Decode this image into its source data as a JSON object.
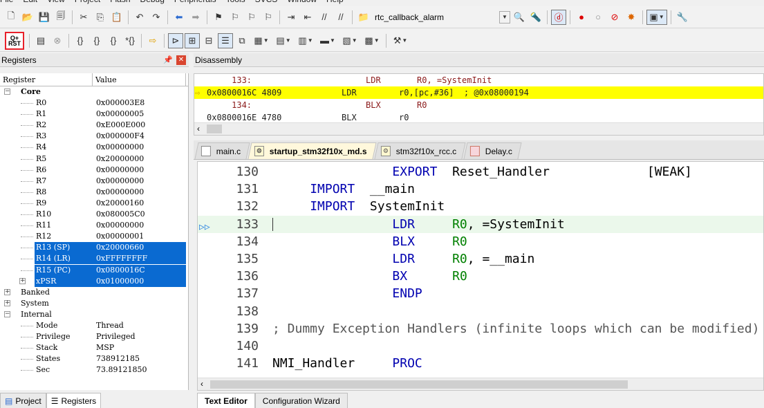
{
  "menu": [
    "File",
    "Edit",
    "View",
    "Project",
    "Flash",
    "Debug",
    "Peripherals",
    "Tools",
    "SVCS",
    "Window",
    "Help"
  ],
  "toolbar": {
    "target_name": "rtc_callback_alarm",
    "reset_label": "RST",
    "reset_top": "Q+"
  },
  "registers": {
    "title": "Registers",
    "col_register": "Register",
    "col_value": "Value",
    "rows": [
      {
        "name": "Core",
        "value": "",
        "type": "grp"
      },
      {
        "name": "R0",
        "value": "0x000003E8"
      },
      {
        "name": "R1",
        "value": "0x00000005"
      },
      {
        "name": "R2",
        "value": "0xE000E000"
      },
      {
        "name": "R3",
        "value": "0x000000F4"
      },
      {
        "name": "R4",
        "value": "0x00000000"
      },
      {
        "name": "R5",
        "value": "0x20000000"
      },
      {
        "name": "R6",
        "value": "0x00000000"
      },
      {
        "name": "R7",
        "value": "0x00000000"
      },
      {
        "name": "R8",
        "value": "0x00000000"
      },
      {
        "name": "R9",
        "value": "0x20000160"
      },
      {
        "name": "R10",
        "value": "0x080005C0"
      },
      {
        "name": "R11",
        "value": "0x00000000"
      },
      {
        "name": "R12",
        "value": "0x00000001"
      },
      {
        "name": "R13 (SP)",
        "value": "0x20000660",
        "sel": true
      },
      {
        "name": "R14 (LR)",
        "value": "0xFFFFFFFF",
        "sel": true
      },
      {
        "name": "R15 (PC)",
        "value": "0x0800016C",
        "sel": true
      },
      {
        "name": "xPSR",
        "value": "0x01000000",
        "sel": true
      },
      {
        "name": "Banked",
        "value": "",
        "type": "grp2"
      },
      {
        "name": "System",
        "value": "",
        "type": "grp2"
      },
      {
        "name": "Internal",
        "value": "",
        "type": "grp2"
      },
      {
        "name": "Mode",
        "value": "Thread"
      },
      {
        "name": "Privilege",
        "value": "Privileged"
      },
      {
        "name": "Stack",
        "value": "MSP"
      },
      {
        "name": "States",
        "value": "738912185"
      },
      {
        "name": "Sec",
        "value": "73.89121850"
      }
    ]
  },
  "bottom_tabs": {
    "project": "Project",
    "registers": "Registers"
  },
  "disassembly": {
    "title": "Disassembly",
    "lines": [
      {
        "a": "     133:",
        "b": "LDR",
        "c": "R0, =SystemInit",
        "src": true
      },
      {
        "a": "0x0800016C 4809",
        "b": "LDR",
        "c": "r0,[pc,#36]  ; @0x08000194",
        "hl": true
      },
      {
        "a": "     134:",
        "b": "BLX",
        "c": "R0",
        "src": true
      },
      {
        "a": "0x0800016E 4780",
        "b": "BLX",
        "c": "r0"
      }
    ]
  },
  "file_tabs": [
    "main.c",
    "startup_stm32f10x_md.s",
    "stm32f10x_rcc.c",
    "Delay.c"
  ],
  "editor": {
    "lines": [
      {
        "n": "130",
        "t": "                EXPORT  Reset_Handler             [WEAK]"
      },
      {
        "n": "131",
        "t": "     IMPORT  __main"
      },
      {
        "n": "132",
        "t": "     IMPORT  SystemInit"
      },
      {
        "n": "133",
        "t": "                LDR     R0, =SystemInit"
      },
      {
        "n": "134",
        "t": "                BLX     R0"
      },
      {
        "n": "135",
        "t": "                LDR     R0, =__main"
      },
      {
        "n": "136",
        "t": "                BX      R0"
      },
      {
        "n": "137",
        "t": "                ENDP"
      },
      {
        "n": "138",
        "t": ""
      },
      {
        "n": "139",
        "t": "; Dummy Exception Handlers (infinite loops which can be modified)"
      },
      {
        "n": "140",
        "t": ""
      },
      {
        "n": "141",
        "t": "NMI_Handler     PROC"
      }
    ]
  },
  "editor_tabs": {
    "text": "Text Editor",
    "config": "Configuration Wizard"
  },
  "colors": {
    "highlight": "#ffff00",
    "selection": "#0a6ad1",
    "current_line": "#ebf8eb",
    "reset_border": "#e8202a"
  }
}
